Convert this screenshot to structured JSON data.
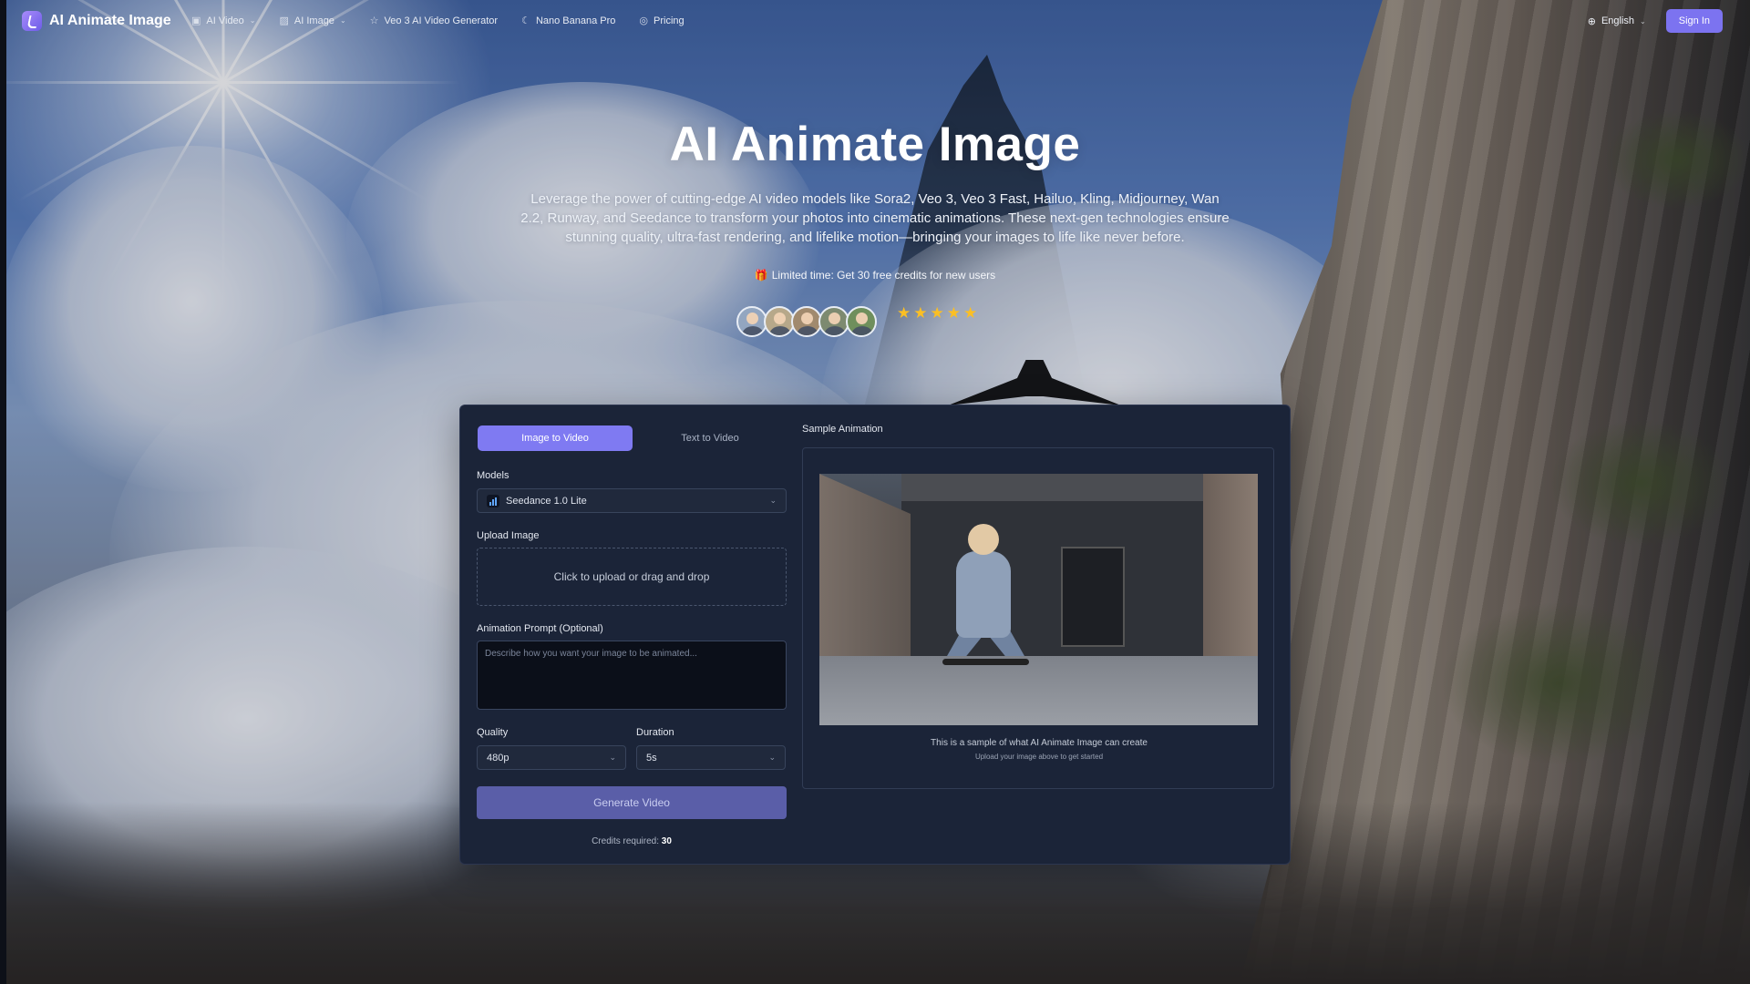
{
  "nav": {
    "brand": "AI Animate Image",
    "items": [
      {
        "label": "AI Video",
        "icon": "film-icon",
        "has_dropdown": true
      },
      {
        "label": "AI Image",
        "icon": "image-icon",
        "has_dropdown": true
      },
      {
        "label": "Veo 3 AI Video Generator",
        "icon": "star-icon",
        "has_dropdown": false
      },
      {
        "label": "Nano Banana Pro",
        "icon": "banana-icon",
        "has_dropdown": false
      },
      {
        "label": "Pricing",
        "icon": "pricing-icon",
        "has_dropdown": false
      }
    ],
    "language": "English",
    "sign_in": "Sign In"
  },
  "hero": {
    "title": "AI Animate Image",
    "description": "Leverage the power of cutting-edge AI video models like Sora2, Veo 3, Veo 3 Fast, Hailuo, Kling, Midjourney, Wan 2.2, Runway, and Seedance to transform your photos into cinematic animations. These next-gen technologies ensure stunning quality, ultra-fast rendering, and lifelike motion—bringing your images to life like never before.",
    "promo": "Limited time: Get 30 free credits for new users",
    "rating_stars": 5
  },
  "panel": {
    "tabs": [
      {
        "label": "Image to Video",
        "active": true
      },
      {
        "label": "Text to Video",
        "active": false
      }
    ],
    "models_label": "Models",
    "model_selected": "Seedance 1.0 Lite",
    "upload_label": "Upload Image",
    "upload_hint": "Click to upload or drag and drop",
    "prompt_label": "Animation Prompt (Optional)",
    "prompt_placeholder": "Describe how you want your image to be animated...",
    "quality_label": "Quality",
    "quality_value": "480p",
    "duration_label": "Duration",
    "duration_value": "5s",
    "generate": "Generate Video",
    "credits_label": "Credits required:",
    "credits_value": "30",
    "sample_title": "Sample Animation",
    "sample_caption": "This is a sample of what AI Animate Image can create",
    "sample_subcaption": "Upload your image above to get started"
  },
  "colors": {
    "accent": "#7f7af2",
    "panel_bg": "#1b2438",
    "generate_btn": "#5a5ea8",
    "star": "#fbbf24"
  }
}
